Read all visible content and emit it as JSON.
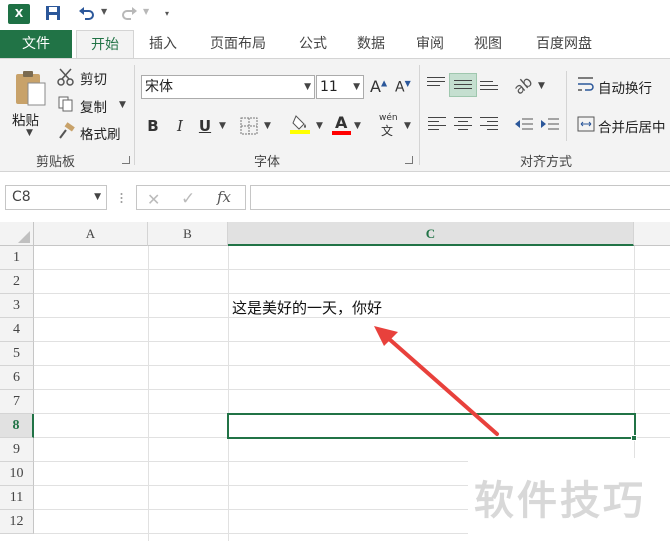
{
  "qat": {
    "app_icon": "X",
    "undo_icon": "undo-icon",
    "redo_icon": "redo-icon",
    "save_icon": "save-icon"
  },
  "tabs": [
    {
      "label": "文件"
    },
    {
      "label": "开始"
    },
    {
      "label": "插入"
    },
    {
      "label": "页面布局"
    },
    {
      "label": "公式"
    },
    {
      "label": "数据"
    },
    {
      "label": "审阅"
    },
    {
      "label": "视图"
    },
    {
      "label": "百度网盘"
    }
  ],
  "ribbon": {
    "clipboard": {
      "paste": "粘贴",
      "cut": "剪切",
      "copy": "复制",
      "format_painter": "格式刷",
      "group_label": "剪贴板"
    },
    "font": {
      "font_name": "宋体",
      "font_size": "11",
      "grow": "A",
      "shrink": "A",
      "bold": "B",
      "italic": "I",
      "underline": "U",
      "font_color_letter": "A",
      "phonetic": "wén",
      "group_label": "字体",
      "fill_color": "#ffff00",
      "font_color": "#ff0000"
    },
    "alignment": {
      "wrap_text": "自动换行",
      "merge_center": "合并后居中",
      "group_label": "对齐方式"
    }
  },
  "formula_bar": {
    "name_box": "C8",
    "fx": "fx",
    "formula": ""
  },
  "grid": {
    "columns": [
      "A",
      "B",
      "C"
    ],
    "rows": [
      "1",
      "2",
      "3",
      "4",
      "5",
      "6",
      "7",
      "8",
      "9",
      "10",
      "11",
      "12"
    ],
    "active_column": "C",
    "active_row": "8",
    "cell_c3": "这是美好的一天，你好",
    "accent": "#217346"
  },
  "annotation": {
    "arrow_color": "#e8413c"
  },
  "watermark": "软件技巧"
}
